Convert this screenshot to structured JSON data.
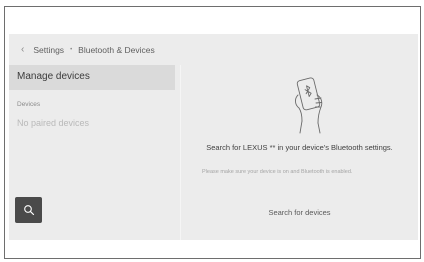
{
  "breadcrumb": {
    "back_icon": "chevron-left-icon",
    "items": [
      "Settings",
      "Bluetooth & Devices"
    ],
    "separator": "•"
  },
  "sidebar": {
    "selected_item": "Manage devices",
    "section_header": "Devices",
    "empty_text": "No paired devices",
    "search_icon": "search-icon"
  },
  "main": {
    "illustration_icon": "phone-bluetooth-icon",
    "instruction": "Search for LEXUS ** in your device's Bluetooth settings.",
    "note": "Please make sure your device is on and Bluetooth is enabled.",
    "search_button_label": "Search for devices"
  },
  "colors": {
    "screen_bg": "#ececec",
    "selected_bg": "#dadada",
    "search_button_bg": "#4a4a4a",
    "frame_border": "#6e6e6e"
  }
}
